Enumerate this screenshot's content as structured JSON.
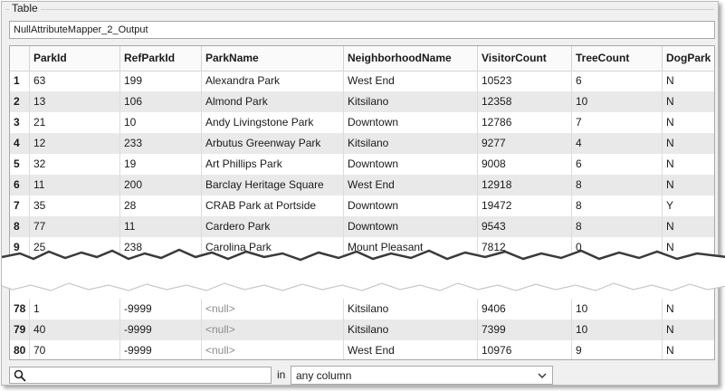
{
  "group_title": "Table",
  "output_name": "NullAttributeMapper_2_Output",
  "columns": [
    "ParkId",
    "RefParkId",
    "ParkName",
    "NeighborhoodName",
    "VisitorCount",
    "TreeCount",
    "DogPark"
  ],
  "rows_top": [
    {
      "n": "1",
      "cells": [
        "63",
        "199",
        "Alexandra Park",
        "West End",
        "10523",
        "6",
        "N"
      ]
    },
    {
      "n": "2",
      "cells": [
        "13",
        "106",
        "Almond Park",
        "Kitsilano",
        "12358",
        "10",
        "N"
      ]
    },
    {
      "n": "3",
      "cells": [
        "21",
        "10",
        "Andy Livingstone Park",
        "Downtown",
        "12786",
        "7",
        "N"
      ]
    },
    {
      "n": "4",
      "cells": [
        "12",
        "233",
        "Arbutus Greenway Park",
        "Kitsilano",
        "9277",
        "4",
        "N"
      ]
    },
    {
      "n": "5",
      "cells": [
        "32",
        "19",
        "Art Phillips Park",
        "Downtown",
        "9008",
        "6",
        "N"
      ]
    },
    {
      "n": "6",
      "cells": [
        "11",
        "200",
        "Barclay Heritage Square",
        "West End",
        "12918",
        "8",
        "N"
      ]
    },
    {
      "n": "7",
      "cells": [
        "35",
        "28",
        "CRAB Park at Portside",
        "Downtown",
        "19472",
        "8",
        "Y"
      ]
    },
    {
      "n": "8",
      "cells": [
        "77",
        "11",
        "Cardero Park",
        "Downtown",
        "9543",
        "8",
        "N"
      ]
    },
    {
      "n": "9",
      "cells": [
        "25",
        "238",
        "Carolina Park",
        "Mount Pleasant",
        "7812",
        "0",
        "N"
      ]
    }
  ],
  "rows_bottom": [
    {
      "n": "78",
      "cells": [
        "1",
        "-9999",
        "<null>",
        "Kitsilano",
        "9406",
        "10",
        "N"
      ]
    },
    {
      "n": "79",
      "cells": [
        "40",
        "-9999",
        "<null>",
        "Kitsilano",
        "7399",
        "10",
        "N"
      ]
    },
    {
      "n": "80",
      "cells": [
        "70",
        "-9999",
        "<null>",
        "West End",
        "10976",
        "9",
        "N"
      ]
    }
  ],
  "search": {
    "placeholder": ""
  },
  "in_label": "in",
  "column_select": {
    "value": "any column"
  }
}
